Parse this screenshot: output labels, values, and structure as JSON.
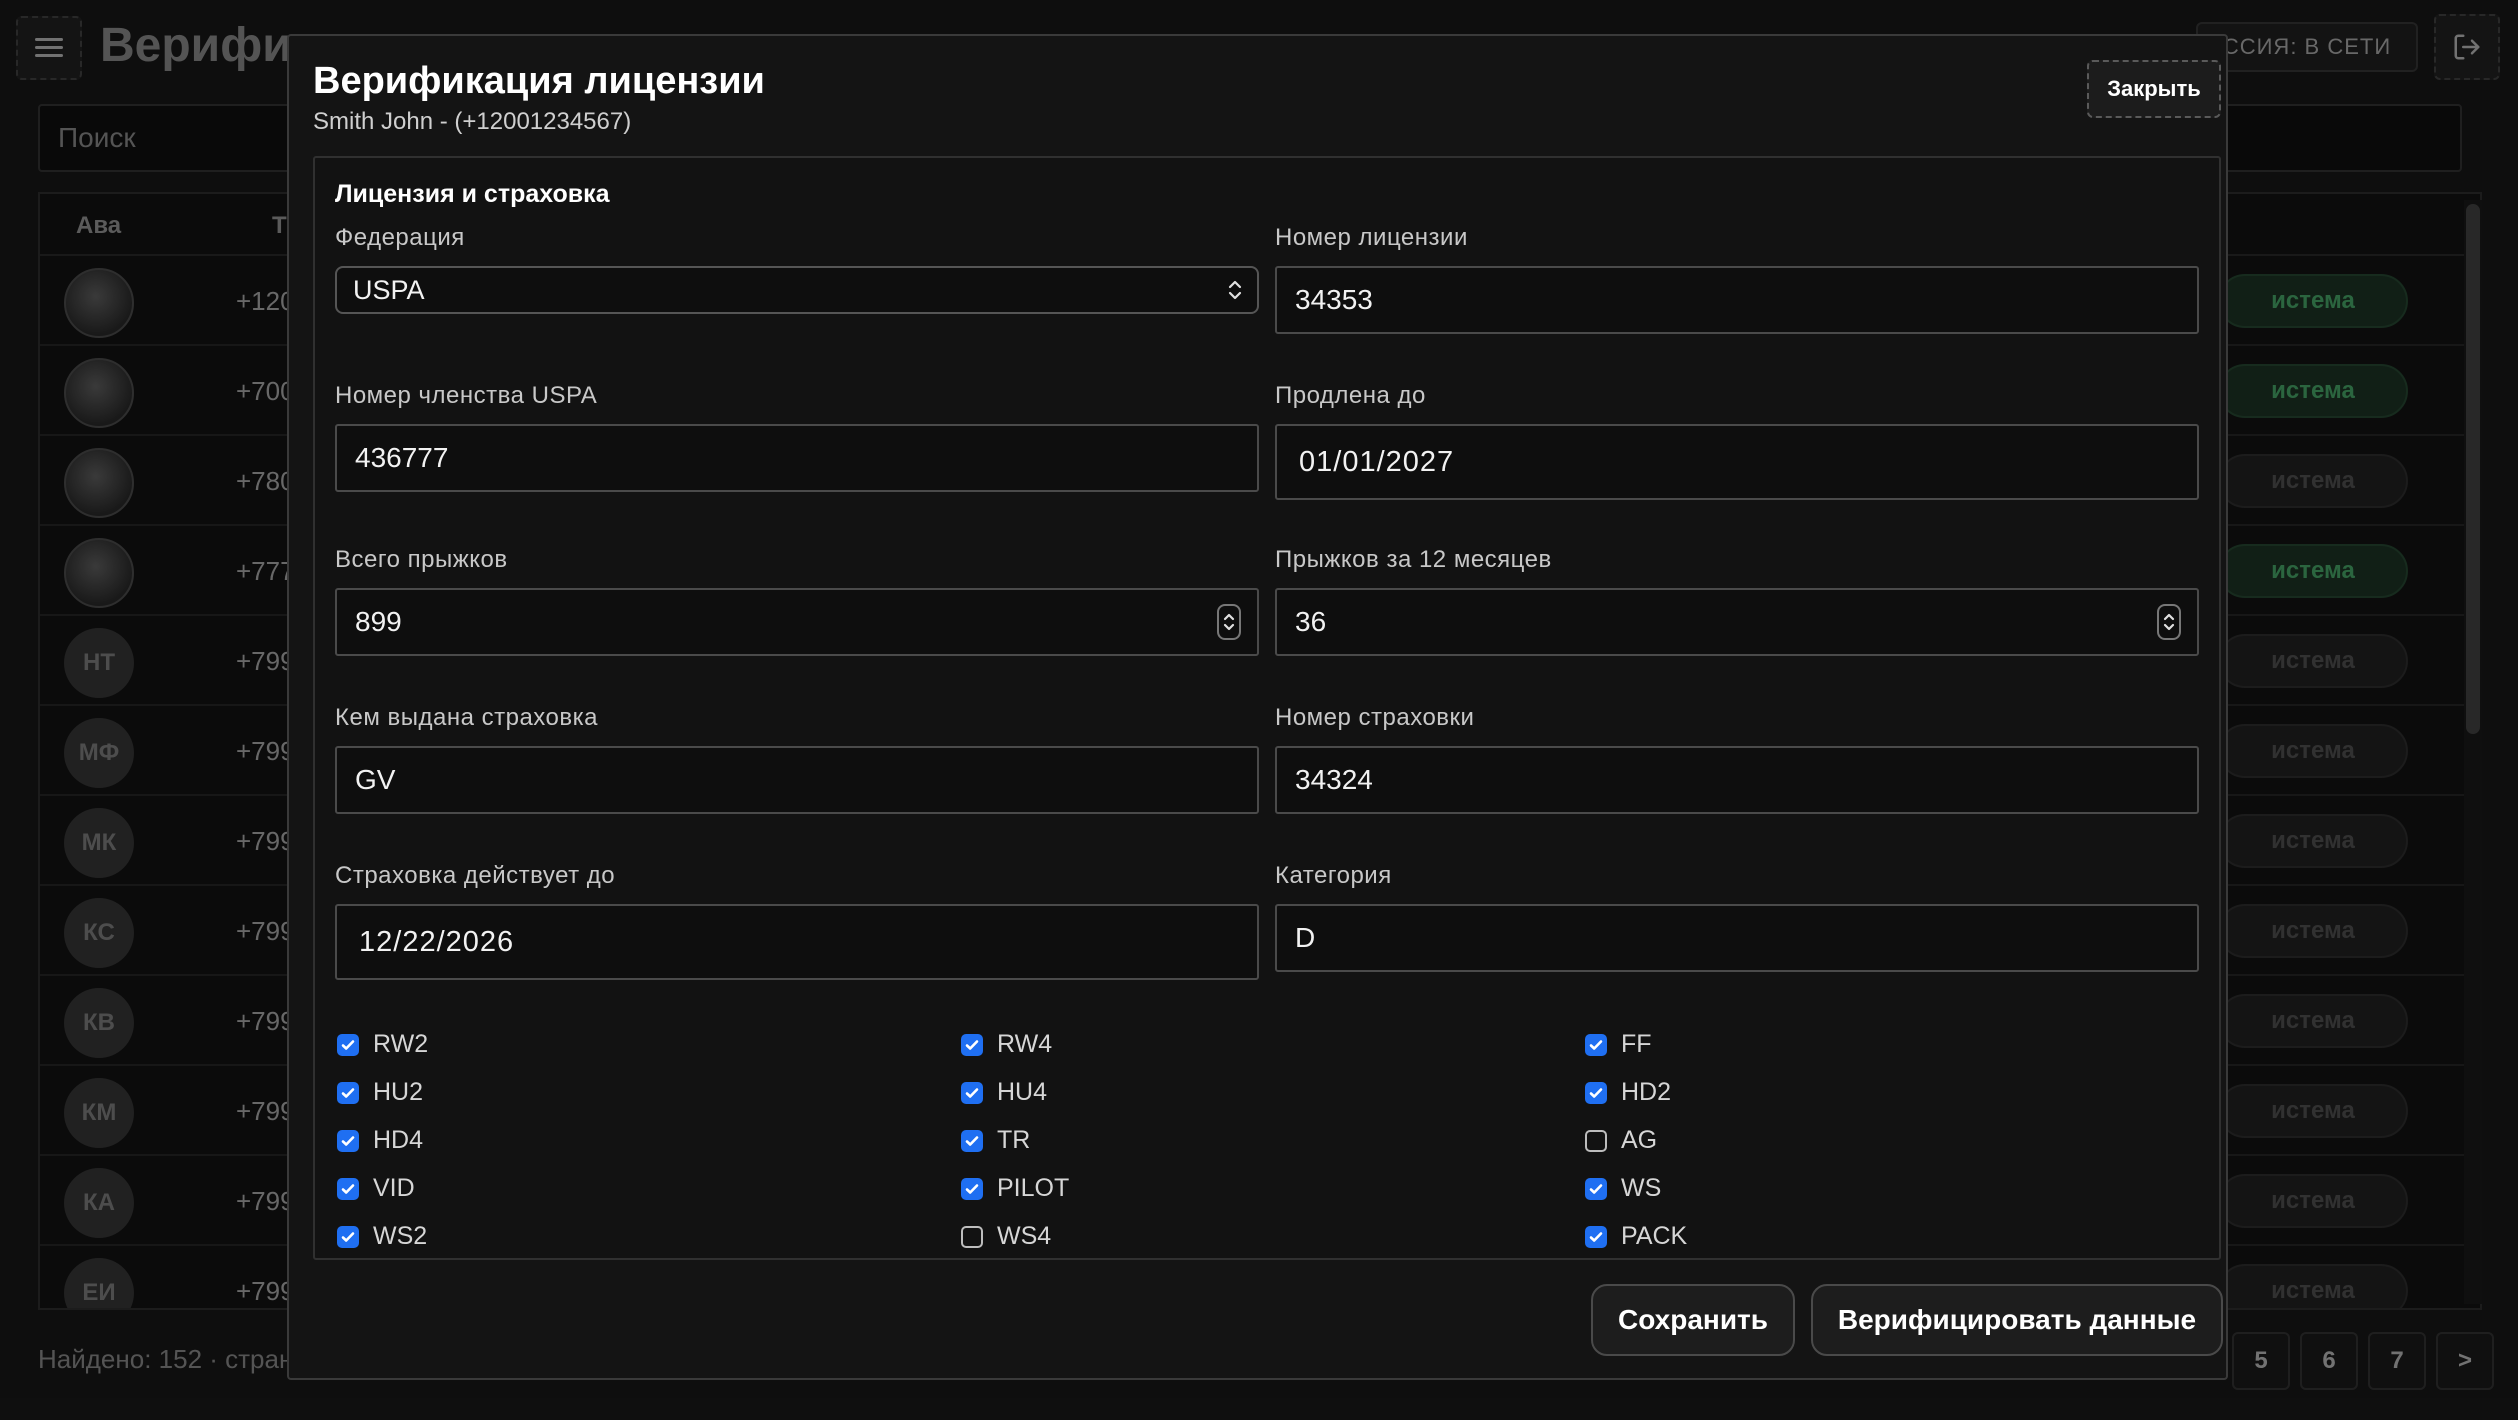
{
  "background": {
    "title": "Верифи",
    "session_status": "ССИЯ: В СЕТИ",
    "search": {
      "placeholder": "Поиск"
    },
    "table": {
      "columns": [
        "Ава",
        "Т"
      ],
      "rows": [
        {
          "avatar": "",
          "phone": "+120",
          "system": "истема",
          "active": true
        },
        {
          "avatar": "",
          "phone": "+700",
          "system": "истема",
          "active": true
        },
        {
          "avatar": "",
          "phone": "+780",
          "system": "истема",
          "active": false
        },
        {
          "avatar": "",
          "phone": "+777",
          "system": "истема",
          "active": true
        },
        {
          "avatar": "НТ",
          "phone": "+799",
          "system": "истема",
          "active": false
        },
        {
          "avatar": "МФ",
          "phone": "+799",
          "system": "истема",
          "active": false
        },
        {
          "avatar": "МК",
          "phone": "+799",
          "system": "истема",
          "active": false
        },
        {
          "avatar": "КС",
          "phone": "+799",
          "system": "истема",
          "active": false
        },
        {
          "avatar": "КВ",
          "phone": "+799",
          "system": "истема",
          "active": false
        },
        {
          "avatar": "КМ",
          "phone": "+799",
          "system": "истема",
          "active": false
        },
        {
          "avatar": "КА",
          "phone": "+799",
          "system": "истема",
          "active": false
        },
        {
          "avatar": "ЕИ",
          "phone": "+799",
          "system": "истема",
          "active": false
        }
      ]
    },
    "footer": "Найдено: 152 · страни",
    "pagination": [
      "5",
      "6",
      "7",
      ">"
    ]
  },
  "modal": {
    "title": "Верификация лицензии",
    "subtitle": "Smith John - (+12001234567)",
    "close_label": "Закрыть",
    "section_title": "Лицензия и страховка",
    "federation": {
      "label": "Федерация",
      "value": "USPA"
    },
    "license_number": {
      "label": "Номер лицензии",
      "value": "34353"
    },
    "membership_number": {
      "label": "Номер членства USPA",
      "value": "436777"
    },
    "renewed_until": {
      "label": "Продлена до",
      "value": "01/01/2027"
    },
    "total_jumps": {
      "label": "Всего прыжков",
      "value": "899"
    },
    "jumps_12m": {
      "label": "Прыжков за 12 месяцев",
      "value": "36"
    },
    "insurer": {
      "label": "Кем выдана страховка",
      "value": "GV"
    },
    "insurance_number": {
      "label": "Номер страховки",
      "value": "34324"
    },
    "insurance_valid_until": {
      "label": "Страховка действует до",
      "value": "12/22/2026"
    },
    "category": {
      "label": "Категория",
      "value": "D"
    },
    "ratings": [
      {
        "label": "RW2",
        "checked": true
      },
      {
        "label": "RW4",
        "checked": true
      },
      {
        "label": "FF",
        "checked": true
      },
      {
        "label": "HU2",
        "checked": true
      },
      {
        "label": "HU4",
        "checked": true
      },
      {
        "label": "HD2",
        "checked": true
      },
      {
        "label": "HD4",
        "checked": true
      },
      {
        "label": "TR",
        "checked": true
      },
      {
        "label": "AG",
        "checked": false
      },
      {
        "label": "VID",
        "checked": true
      },
      {
        "label": "PILOT",
        "checked": true
      },
      {
        "label": "WS",
        "checked": true
      },
      {
        "label": "WS2",
        "checked": true
      },
      {
        "label": "WS4",
        "checked": false
      },
      {
        "label": "PACK",
        "checked": true
      }
    ],
    "save_label": "Сохранить",
    "verify_label": "Верифицировать данные"
  },
  "colors": {
    "accent": "#1f6ff2",
    "active_status": "#4fb873",
    "modal_background": "#141414"
  }
}
